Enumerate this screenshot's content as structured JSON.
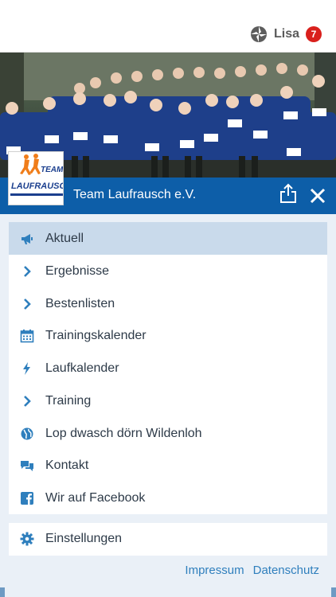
{
  "user": {
    "name": "Lisa",
    "notifications": "7"
  },
  "club": {
    "title": "Team Laufrausch e.V.",
    "logo_line1": "TEAM",
    "logo_line2": "LAUFRAUSCH"
  },
  "menu": {
    "items": [
      {
        "label": "Aktuell",
        "icon": "megaphone-icon"
      },
      {
        "label": "Ergebnisse",
        "icon": "chevron-right-icon"
      },
      {
        "label": "Bestenlisten",
        "icon": "chevron-right-icon"
      },
      {
        "label": "Trainingskalender",
        "icon": "calendar-icon"
      },
      {
        "label": "Laufkalender",
        "icon": "lightning-icon"
      },
      {
        "label": "Training",
        "icon": "chevron-right-icon"
      },
      {
        "label": "Lop dwasch dörn Wildenloh",
        "icon": "globe-icon"
      },
      {
        "label": "Kontakt",
        "icon": "chat-icon"
      },
      {
        "label": "Wir auf Facebook",
        "icon": "facebook-icon"
      }
    ],
    "settings": "Einstellungen"
  },
  "footer": {
    "impressum": "Impressum",
    "datenschutz": "Datenschutz"
  },
  "colors": {
    "brand_blue": "#0d5ea8",
    "active_bg": "#c9daeb",
    "icon_blue": "#2f7fbd",
    "badge_red": "#d9201c"
  }
}
